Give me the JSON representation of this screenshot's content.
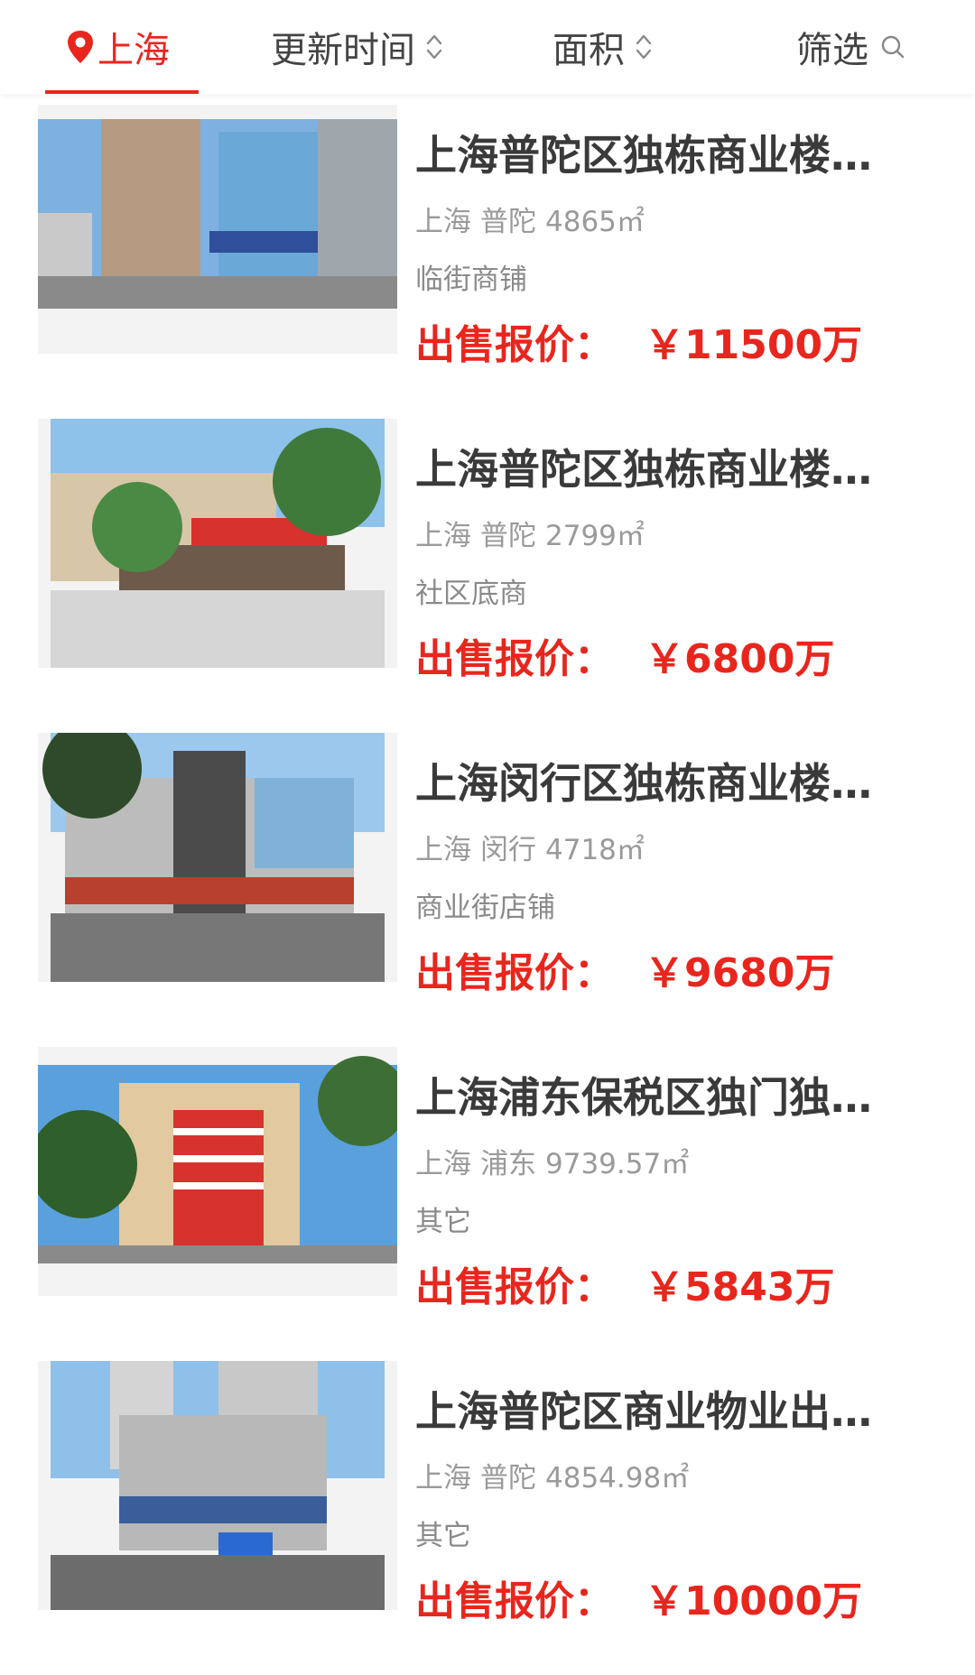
{
  "filters": {
    "city": "上海",
    "time": "更新时间",
    "area": "面积",
    "filter": "筛选"
  },
  "colors": {
    "accent": "#e8261d"
  },
  "listings": [
    {
      "title": "上海普陀区独栋商业楼出…",
      "city": "上海",
      "district": "普陀",
      "area": "4865㎡",
      "type": "临街商铺",
      "price_label": "出售报价：",
      "price": "￥11500万"
    },
    {
      "title": "上海普陀区独栋商业楼物…",
      "city": "上海",
      "district": "普陀",
      "area": "2799㎡",
      "type": "社区底商",
      "price_label": "出售报价：",
      "price": "￥6800万"
    },
    {
      "title": "上海闵行区独栋商业楼出…",
      "city": "上海",
      "district": "闵行",
      "area": "4718㎡",
      "type": "商业街店铺",
      "price_label": "出售报价：",
      "price": "￥9680万"
    },
    {
      "title": "上海浦东保税区独门独院…",
      "city": "上海",
      "district": "浦东",
      "area": "9739.57㎡",
      "type": "其它",
      "price_label": "出售报价：",
      "price": "￥5843万"
    },
    {
      "title": "上海普陀区商业物业出售…",
      "city": "上海",
      "district": "普陀",
      "area": "4854.98㎡",
      "type": "其它",
      "price_label": "出售报价：",
      "price": "￥10000万"
    }
  ]
}
